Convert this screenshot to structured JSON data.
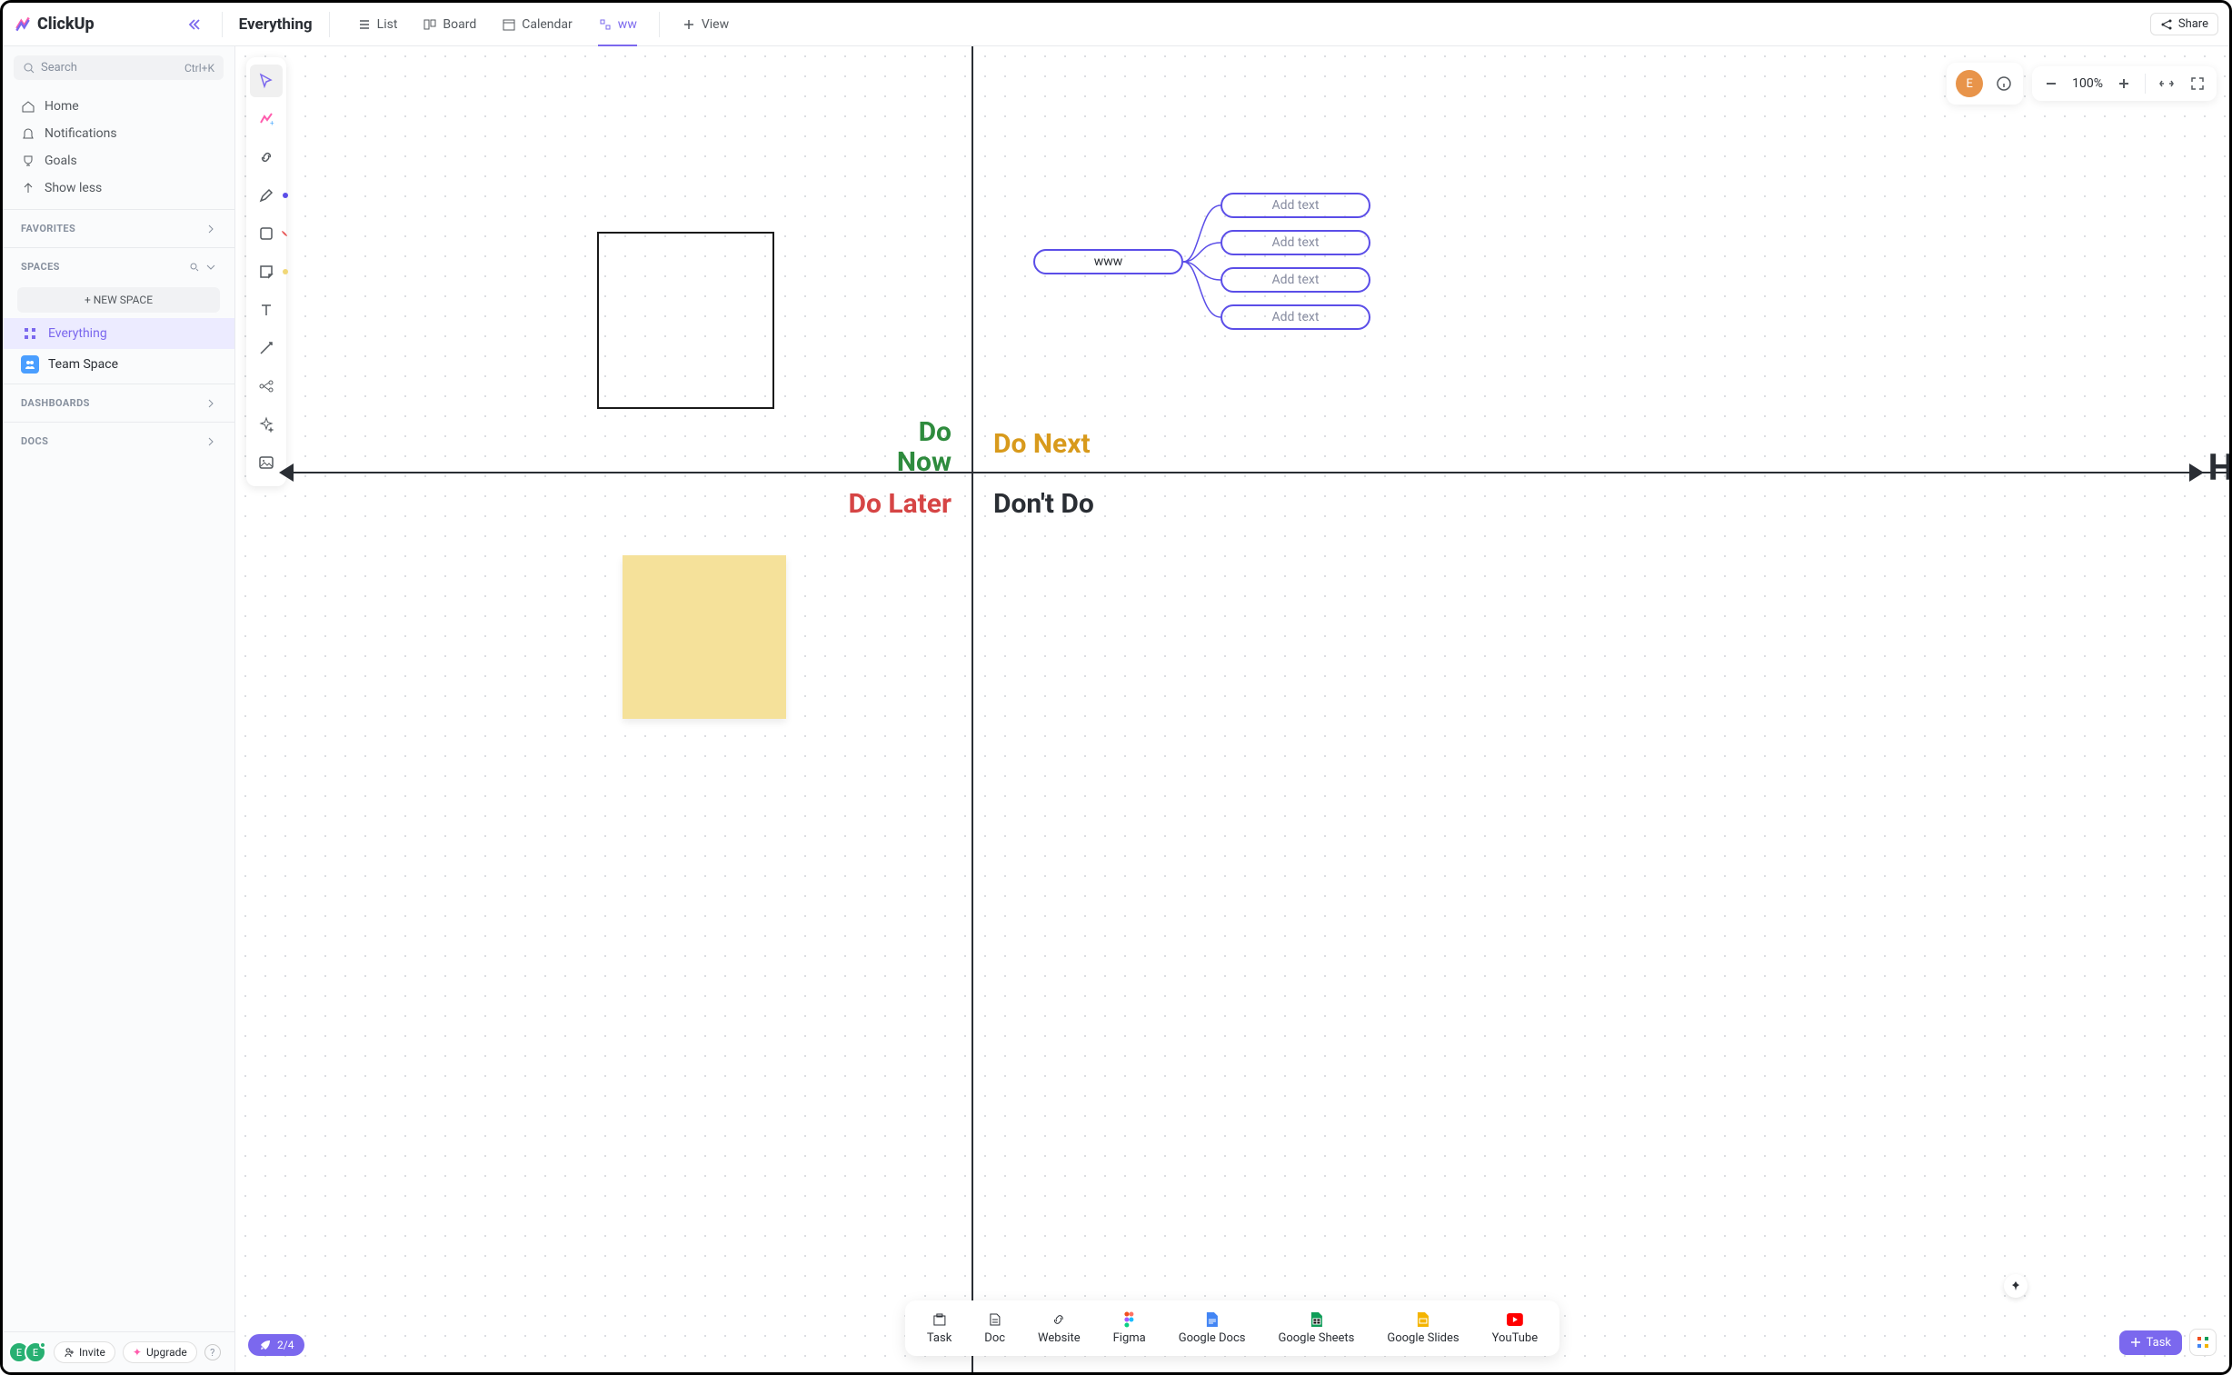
{
  "logo": "ClickUp",
  "breadcrumb": "Everything",
  "tabs": [
    {
      "label": "List"
    },
    {
      "label": "Board"
    },
    {
      "label": "Calendar"
    },
    {
      "label": "ww",
      "active": true
    },
    {
      "label": "View"
    }
  ],
  "share": "Share",
  "search": {
    "placeholder": "Search",
    "kbd": "Ctrl+K"
  },
  "nav": {
    "home": "Home",
    "notifications": "Notifications",
    "goals": "Goals",
    "showless": "Show less"
  },
  "favorites_label": "FAVORITES",
  "spaces_label": "SPACES",
  "new_space": "NEW SPACE",
  "spaces": [
    {
      "label": "Everything"
    },
    {
      "label": "Team Space"
    }
  ],
  "dashboards_label": "DASHBOARDS",
  "docs_label": "DOCS",
  "sidebar_footer": {
    "invite": "Invite",
    "upgrade": "Upgrade",
    "avatar_letter": "E"
  },
  "zoom": {
    "label": "100%"
  },
  "user": {
    "initial": "E"
  },
  "quadrants": {
    "do_now": "Do\nNow",
    "do_next": "Do Next",
    "do_later": "Do Later",
    "dont_do": "Don't Do",
    "axis_end": "H"
  },
  "mindmap": {
    "root": "www",
    "children": [
      "Add text",
      "Add text",
      "Add text",
      "Add text"
    ]
  },
  "bottom_toolbar": [
    {
      "label": "Task"
    },
    {
      "label": "Doc"
    },
    {
      "label": "Website"
    },
    {
      "label": "Figma"
    },
    {
      "label": "Google Docs"
    },
    {
      "label": "Google Sheets"
    },
    {
      "label": "Google Slides"
    },
    {
      "label": "YouTube"
    }
  ],
  "progress_pill": "2/4",
  "task_button": "Task"
}
